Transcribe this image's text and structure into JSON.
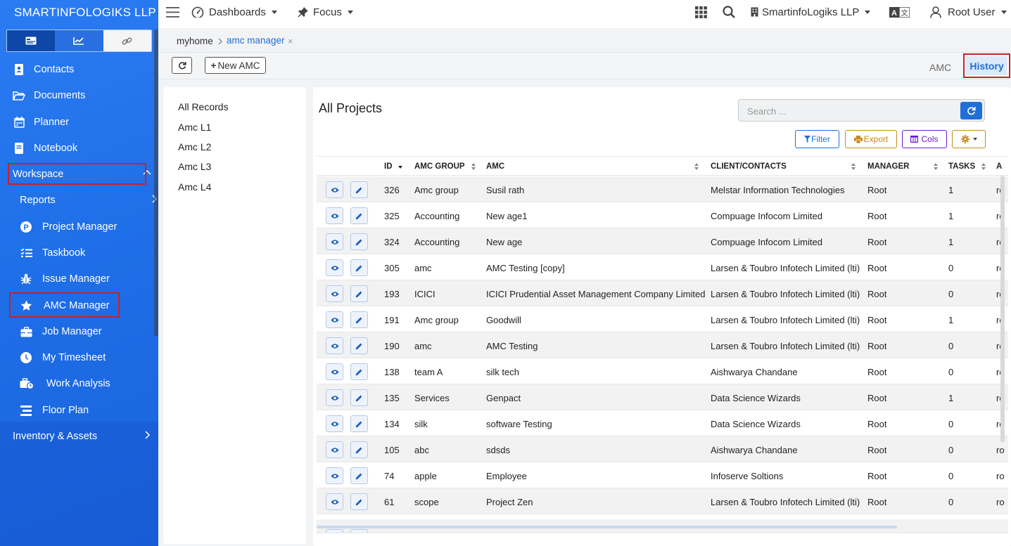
{
  "app": {
    "brand": "SMARTINFOLOGIKS LLP"
  },
  "sidebar": {
    "tabs": [
      {
        "icon": "id-card-icon",
        "label": ""
      },
      {
        "icon": "chart-line-icon",
        "label": ""
      },
      {
        "icon": "link-icon",
        "label": ""
      }
    ],
    "items": [
      {
        "label": "Contacts",
        "icon": "contact-book-icon"
      },
      {
        "label": "Documents",
        "icon": "folder-open-icon"
      },
      {
        "label": "Planner",
        "icon": "calendar-icon"
      },
      {
        "label": "Notebook",
        "icon": "notebook-icon"
      },
      {
        "label": "Workspace",
        "icon": "chevron-up-icon"
      },
      {
        "label": "Reports",
        "icon": "chevron-right-icon"
      },
      {
        "label": "Project Manager",
        "icon": "project-p-icon"
      },
      {
        "label": "Taskbook",
        "icon": "task-list-icon"
      },
      {
        "label": "Issue Manager",
        "icon": "bug-icon"
      },
      {
        "label": "AMC Manager",
        "icon": "star-icon"
      },
      {
        "label": "Job Manager",
        "icon": "briefcase-icon"
      },
      {
        "label": "My Timesheet",
        "icon": "clock-icon"
      },
      {
        "label": "Work Analysis",
        "icon": "analysis-icon"
      },
      {
        "label": "Floor Plan",
        "icon": "floor-plan-icon"
      },
      {
        "label": "Inventory & Assets",
        "icon": "chevron-right-icon"
      }
    ]
  },
  "topbar": {
    "dashboards": "Dashboards",
    "focus": "Focus",
    "company": "SmartinfoLogiks LLP",
    "user": "Root User",
    "translate_icon": "translate-icon"
  },
  "breadcrumb": {
    "home": "myhome",
    "current": "amc manager",
    "close": "×"
  },
  "toolbar": {
    "new_label": "New AMC",
    "new_prefix": "+",
    "tab_amc": "AMC",
    "tab_history": "History"
  },
  "left_list": [
    "All Records",
    "Amc L1",
    "Amc L2",
    "Amc L3",
    "Amc L4"
  ],
  "main": {
    "title": "All Projects",
    "search_placeholder": "Search ...",
    "buttons": {
      "filter": "Filter",
      "export": "Export",
      "cols": "Cols"
    },
    "colors": {
      "filter": "#1e6fd9",
      "export": "#c98a1a",
      "cols": "#6a1bd1",
      "settings": "#c98a1a"
    }
  },
  "table": {
    "headers": [
      "ID",
      "AMC GROUP",
      "AMC",
      "CLIENT/CONTACTS",
      "MANAGER",
      "TASKS",
      "A"
    ],
    "rows": [
      {
        "id": "326",
        "group": "Amc group",
        "amc": "Susil rath",
        "client": "Melstar Information Technologies",
        "manager": "Root",
        "tasks": "1",
        "extra": "ro"
      },
      {
        "id": "325",
        "group": "Accounting",
        "amc": "New age1",
        "client": "Compuage Infocom Limited",
        "manager": "Root",
        "tasks": "1",
        "extra": "ro"
      },
      {
        "id": "324",
        "group": "Accounting",
        "amc": "New age",
        "client": "Compuage Infocom Limited",
        "manager": "Root",
        "tasks": "1",
        "extra": "ro"
      },
      {
        "id": "305",
        "group": "amc",
        "amc": "AMC Testing [copy]",
        "client": "Larsen & Toubro Infotech Limited (lti)",
        "manager": "Root",
        "tasks": "0",
        "extra": "ro"
      },
      {
        "id": "193",
        "group": "ICICI",
        "amc": "ICICI Prudential Asset Management Company Limited",
        "client": "Larsen & Toubro Infotech Limited (lti)",
        "manager": "Root",
        "tasks": "0",
        "extra": "ro"
      },
      {
        "id": "191",
        "group": "Amc group",
        "amc": "Goodwill",
        "client": "Larsen & Toubro Infotech Limited (lti)",
        "manager": "Root",
        "tasks": "1",
        "extra": "ro"
      },
      {
        "id": "190",
        "group": "amc",
        "amc": "AMC Testing",
        "client": "Larsen & Toubro Infotech Limited (lti)",
        "manager": "Root",
        "tasks": "0",
        "extra": "ro"
      },
      {
        "id": "138",
        "group": "team A",
        "amc": "silk tech",
        "client": "Aishwarya Chandane",
        "manager": "Root",
        "tasks": "0",
        "extra": "ro"
      },
      {
        "id": "135",
        "group": "Services",
        "amc": "Genpact",
        "client": "Data Science Wizards",
        "manager": "Root",
        "tasks": "1",
        "extra": "ro"
      },
      {
        "id": "134",
        "group": "silk",
        "amc": "software Testing",
        "client": "Data Science Wizards",
        "manager": "Root",
        "tasks": "0",
        "extra": "ro"
      },
      {
        "id": "105",
        "group": "abc",
        "amc": "sdsds",
        "client": "Aishwarya Chandane",
        "manager": "Root",
        "tasks": "0",
        "extra": "ro"
      },
      {
        "id": "74",
        "group": "apple",
        "amc": "Employee",
        "client": "Infoserve Soltions",
        "manager": "Root",
        "tasks": "0",
        "extra": "ro"
      },
      {
        "id": "61",
        "group": "scope",
        "amc": "Project Zen",
        "client": "Larsen & Toubro Infotech Limited (lti)",
        "manager": "Root",
        "tasks": "0",
        "extra": "ro"
      }
    ]
  }
}
